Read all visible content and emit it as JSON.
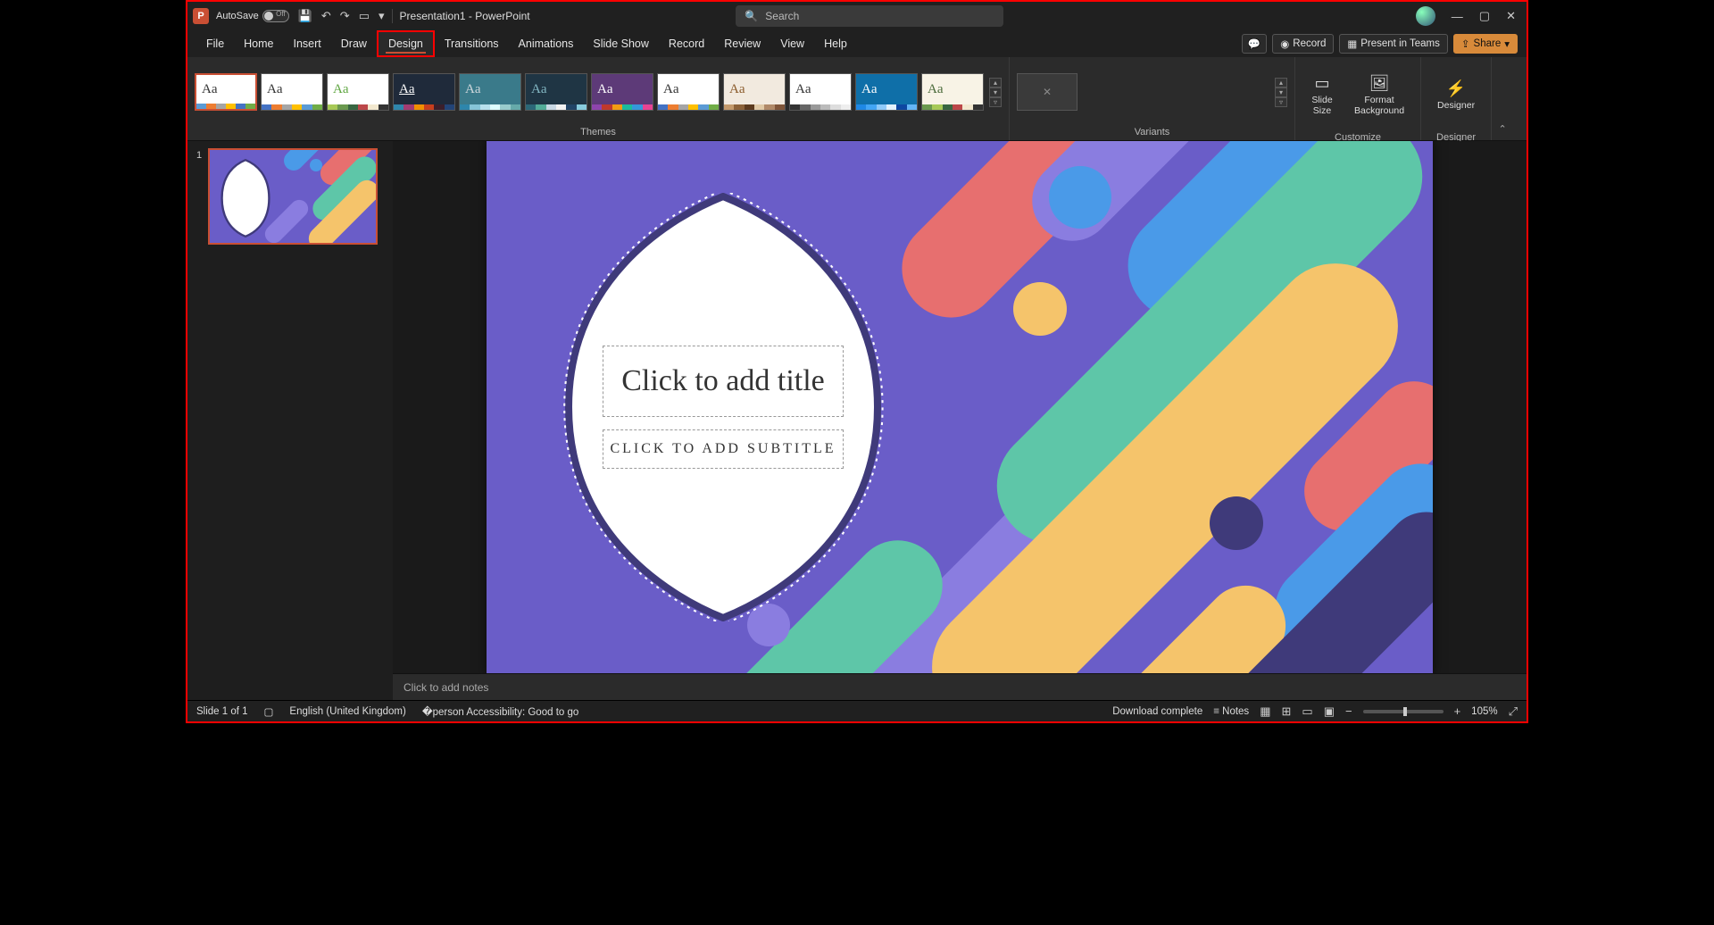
{
  "title": {
    "autosave": "AutoSave",
    "autosave_state": "Off",
    "document": "Presentation1 - PowerPoint",
    "search_placeholder": "Search"
  },
  "tabs": [
    "File",
    "Home",
    "Insert",
    "Draw",
    "Design",
    "Transitions",
    "Animations",
    "Slide Show",
    "Record",
    "Review",
    "View",
    "Help"
  ],
  "active_tab": "Design",
  "ribbon_right": {
    "record": "Record",
    "teams": "Present in Teams",
    "share": "Share"
  },
  "groups": {
    "themes": "Themes",
    "variants": "Variants",
    "customize": "Customize",
    "designer": "Designer"
  },
  "customize": {
    "slide_size": "Slide\nSize",
    "format_bg": "Format\nBackground"
  },
  "designer_btn": "Designer",
  "themes": [
    {
      "bg": "#ffffff",
      "fg": "#333333",
      "strip": [
        "#5b9bd5",
        "#ed7d31",
        "#a5a5a5",
        "#ffc000",
        "#4472c4",
        "#70ad47"
      ],
      "selected": true
    },
    {
      "bg": "#ffffff",
      "fg": "#333333",
      "strip": [
        "#4472c4",
        "#ed7d31",
        "#a5a5a5",
        "#ffc000",
        "#5b9bd5",
        "#70ad47"
      ]
    },
    {
      "bg": "#ffffff",
      "fg": "#5fa641",
      "strip": [
        "#a7c957",
        "#6a994e",
        "#386641",
        "#bc4749",
        "#f2e8cf",
        "#333"
      ],
      "accent": true
    },
    {
      "bg": "#1f2a3a",
      "fg": "#ffffff",
      "strip": [
        "#2e86ab",
        "#a23b72",
        "#f18f01",
        "#c73e1d",
        "#3b1f2b",
        "#247"
      ],
      "underline": true
    },
    {
      "bg": "#3a7a8a",
      "fg": "#cfd8dc",
      "strip": [
        "#2e86ab",
        "#86c5d8",
        "#b8e0ec",
        "#dff",
        "#9cc",
        "#6aa"
      ],
      "pattern": true
    },
    {
      "bg": "#1f3544",
      "fg": "#84b8c4",
      "strip": [
        "#2b6777",
        "#52ab98",
        "#c8d8e4",
        "#f2f2f2",
        "#246",
        "#8cd"
      ]
    },
    {
      "bg": "#5d3a78",
      "fg": "#ffffff",
      "strip": [
        "#8e44ad",
        "#c0392b",
        "#f39c12",
        "#1abc9c",
        "#3498db",
        "#e84393"
      ]
    },
    {
      "bg": "#ffffff",
      "fg": "#333333",
      "strip": [
        "#4472c4",
        "#ed7d31",
        "#a5a5a5",
        "#ffc000",
        "#5b9bd5",
        "#70ad47"
      ]
    },
    {
      "bg": "#f2eadf",
      "fg": "#8a5a2a",
      "strip": [
        "#c49a6c",
        "#8c6239",
        "#5c3a1e",
        "#e0c9a6",
        "#b08968",
        "#7f5539"
      ]
    },
    {
      "bg": "#ffffff",
      "fg": "#333333",
      "strip": [
        "#333",
        "#666",
        "#999",
        "#bbb",
        "#ddd",
        "#eee"
      ]
    },
    {
      "bg": "#0f6fa8",
      "fg": "#ffffff",
      "strip": [
        "#1e88e5",
        "#42a5f5",
        "#90caf9",
        "#e3f2fd",
        "#0d47a1",
        "#64b5f6"
      ]
    },
    {
      "bg": "#f8f3e6",
      "fg": "#4a6a3a",
      "strip": [
        "#6a994e",
        "#a7c957",
        "#386641",
        "#bc4749",
        "#f2e8cf",
        "#333"
      ]
    }
  ],
  "slide": {
    "number": "1",
    "title_placeholder": "Click to add title",
    "subtitle_placeholder": "CLICK TO ADD SUBTITLE",
    "notes_placeholder": "Click to add notes"
  },
  "status": {
    "slide_of": "Slide 1 of 1",
    "language": "English (United Kingdom)",
    "accessibility": "Accessibility: Good to go",
    "download": "Download complete",
    "notes": "Notes",
    "zoom": "105%"
  },
  "colors": {
    "slide_bg": "#6a5dc8",
    "red": "#e76f6f",
    "teal": "#5ec6a8",
    "yellow": "#f5c46b",
    "blue": "#4a9ae8",
    "purple": "#8a7de0",
    "dark": "#3f3a7a"
  }
}
